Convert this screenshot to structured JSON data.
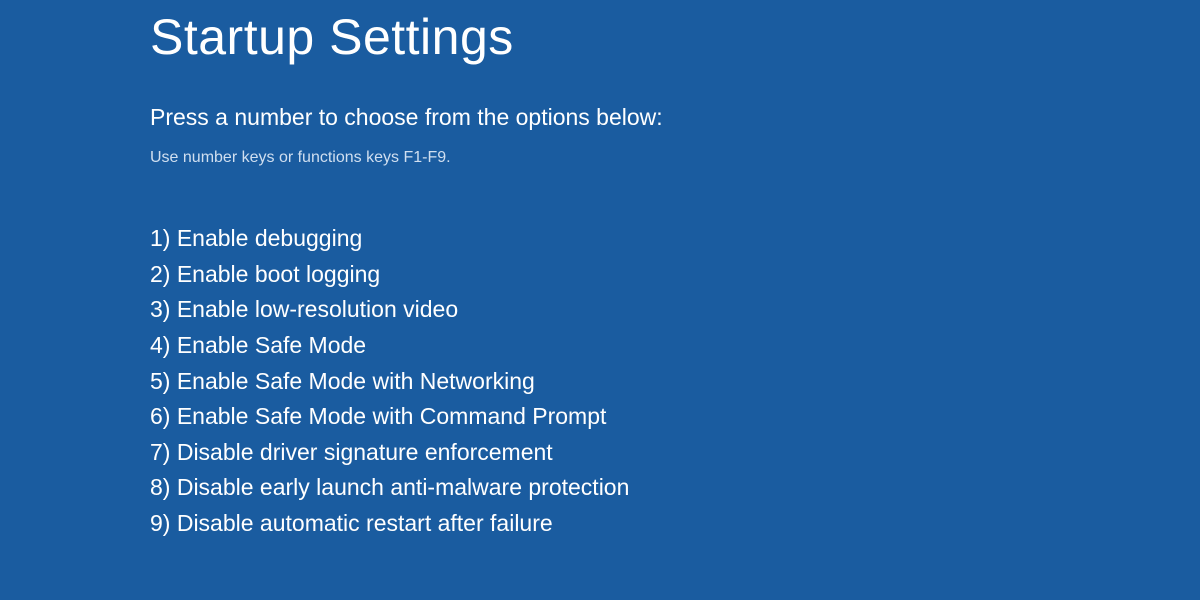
{
  "title": "Startup Settings",
  "subtitle": "Press a number to choose from the options below:",
  "hint": "Use number keys or functions keys F1-F9.",
  "options": [
    "1) Enable debugging",
    "2) Enable boot logging",
    "3) Enable low-resolution video",
    "4) Enable Safe Mode",
    "5) Enable Safe Mode with Networking",
    "6) Enable Safe Mode with Command Prompt",
    "7) Disable driver signature enforcement",
    "8) Disable early launch anti-malware protection",
    "9) Disable automatic restart after failure"
  ],
  "colors": {
    "background": "#1a5ca0",
    "text": "#ffffff",
    "hint": "#d0dff0"
  }
}
